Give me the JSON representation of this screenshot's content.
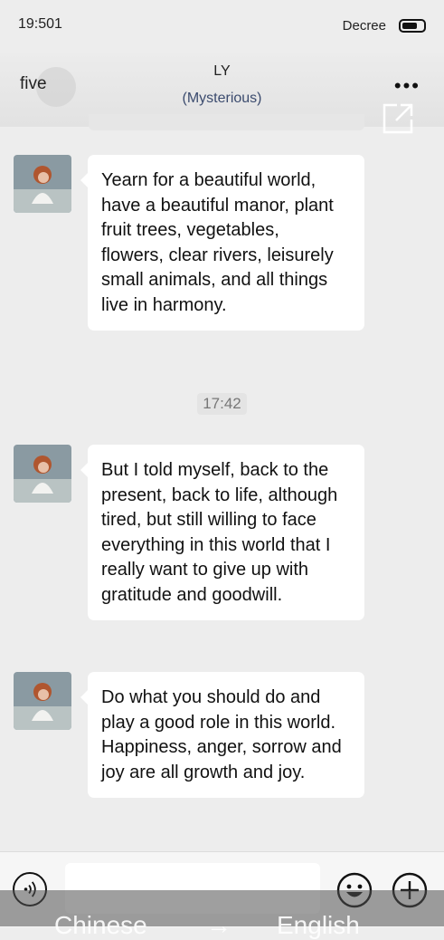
{
  "status_bar": {
    "time": "19:501",
    "carrier": "Decree",
    "battery_level": 0.6
  },
  "nav": {
    "back_label": "five",
    "title": "LY",
    "subtitle": "(Mysterious)",
    "more_label": "•••"
  },
  "messages": [
    {
      "text": "Yearn for a beautiful world, have a beautiful manor, plant fruit trees, vegetables, flowers, clear rivers, leisurely small animals, and all things live in harmony."
    },
    {
      "text": "But I told myself, back to the present, back to life, although tired, but still willing to face everything in this world that I really want to give up with gratitude and goodwill."
    },
    {
      "text": "Do what you should do and play a good role in this world. Happiness, anger, sorrow and joy are all growth and joy."
    }
  ],
  "timestamp": "17:42",
  "input": {
    "value": "",
    "placeholder": ""
  },
  "translate": {
    "from": "Chinese",
    "arrow": "→",
    "to": "English"
  }
}
